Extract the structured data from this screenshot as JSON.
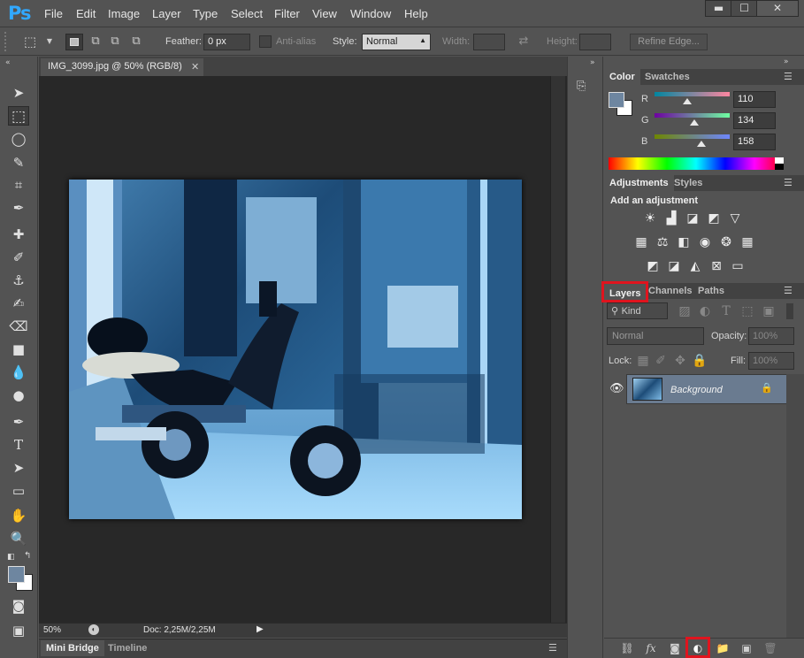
{
  "app": {
    "logo": "Ps"
  },
  "menu": [
    "File",
    "Edit",
    "Image",
    "Layer",
    "Type",
    "Select",
    "Filter",
    "View",
    "Window",
    "Help"
  ],
  "window_controls": {
    "minimize": "▬",
    "maximize": "☐",
    "close": "✕"
  },
  "options": {
    "feather_label": "Feather:",
    "feather_value": "0 px",
    "antialias_label": "Anti-alias",
    "style_label": "Style:",
    "style_value": "Normal",
    "width_label": "Width:",
    "height_label": "Height:",
    "refine_edge": "Refine Edge..."
  },
  "document": {
    "tab_title": "IMG_3099.jpg @ 50% (RGB/8)",
    "zoom": "50%",
    "doc_size": "Doc: 2,25M/2,25M"
  },
  "bottom_tabs": [
    "Mini Bridge",
    "Timeline"
  ],
  "color_panel": {
    "tabs": [
      "Color",
      "Swatches"
    ],
    "foreground": "#6e86a0",
    "channels": [
      {
        "label": "R",
        "value": "110",
        "level": 0.431
      },
      {
        "label": "G",
        "value": "134",
        "level": 0.525
      },
      {
        "label": "B",
        "value": "158",
        "level": 0.62
      }
    ]
  },
  "adjustments_panel": {
    "tabs": [
      "Adjustments",
      "Styles"
    ],
    "heading": "Add an adjustment",
    "icons": [
      "brightness-contrast-icon",
      "levels-icon",
      "curves-icon",
      "exposure-icon",
      "vibrance-icon",
      "hue-saturation-icon",
      "color-balance-icon",
      "black-white-icon",
      "photo-filter-icon",
      "channel-mixer-icon",
      "color-lookup-icon",
      "invert-icon",
      "posterize-icon",
      "threshold-icon",
      "selective-color-icon",
      "gradient-map-icon"
    ]
  },
  "layers_panel": {
    "tabs": [
      "Layers",
      "Channels",
      "Paths"
    ],
    "kind_label": "Kind",
    "blend_mode": "Normal",
    "opacity_label": "Opacity:",
    "opacity_value": "100%",
    "lock_label": "Lock:",
    "fill_label": "Fill:",
    "fill_value": "100%",
    "layers": [
      {
        "name": "Background",
        "locked": true,
        "visible": true
      }
    ],
    "footer_icons": [
      "link-layers-icon",
      "fx-icon",
      "add-mask-icon",
      "new-adjustment-layer-icon",
      "new-group-icon",
      "new-layer-icon",
      "delete-layer-icon"
    ]
  },
  "colors": {
    "highlight": "#e0141e",
    "accent": "#31a8ff"
  }
}
